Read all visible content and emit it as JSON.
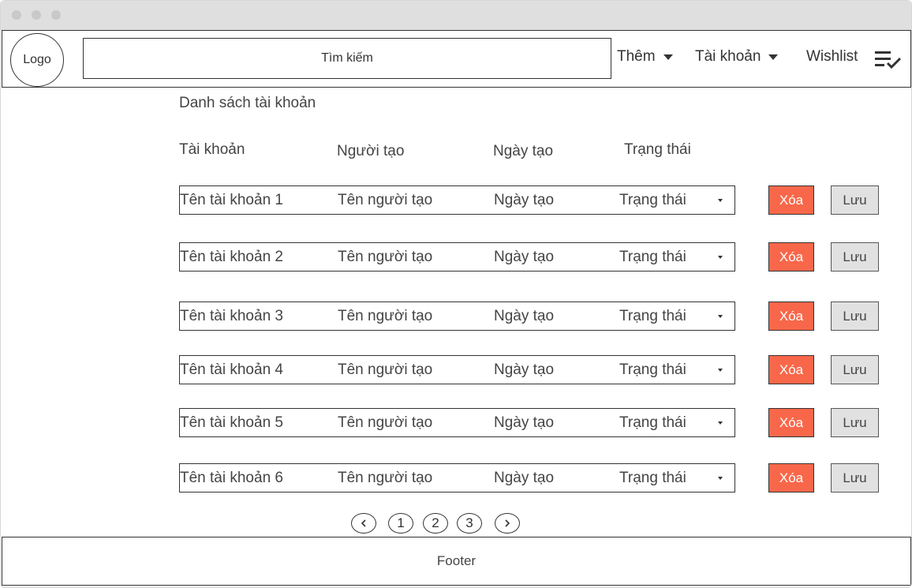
{
  "header": {
    "logo": "Logo",
    "search_placeholder": "Tìm kiếm",
    "nav": {
      "them": "Thêm",
      "tai_khoan": "Tài khoản",
      "wishlist": "Wishlist"
    }
  },
  "page_title": "Danh sách tài khoản",
  "columns": [
    "Tài khoản",
    "Người tạo",
    "Ngày tạo",
    "Trạng thái"
  ],
  "rows": [
    {
      "account": "Tên tài khoản 1",
      "creator": "Tên người tạo",
      "date": "Ngày tạo",
      "status": "Trạng thái"
    },
    {
      "account": "Tên tài khoản 2",
      "creator": "Tên người tạo",
      "date": "Ngày tạo",
      "status": "Trạng thái"
    },
    {
      "account": "Tên tài khoản 3",
      "creator": "Tên người tạo",
      "date": "Ngày tạo",
      "status": "Trạng thái"
    },
    {
      "account": "Tên tài khoản 4",
      "creator": "Tên người tạo",
      "date": "Ngày tạo",
      "status": "Trạng thái"
    },
    {
      "account": "Tên tài khoản 5",
      "creator": "Tên người tạo",
      "date": "Ngày tạo",
      "status": "Trạng thái"
    },
    {
      "account": "Tên tài khoản 6",
      "creator": "Tên người tạo",
      "date": "Ngày tạo",
      "status": "Trạng thái"
    }
  ],
  "actions": {
    "delete": "Xóa",
    "save": "Lưu"
  },
  "pagination": {
    "pages": [
      "1",
      "2",
      "3"
    ]
  },
  "footer": "Footer",
  "colors": {
    "delete_bg": "#f8674a",
    "save_bg": "#e1e1e1"
  }
}
